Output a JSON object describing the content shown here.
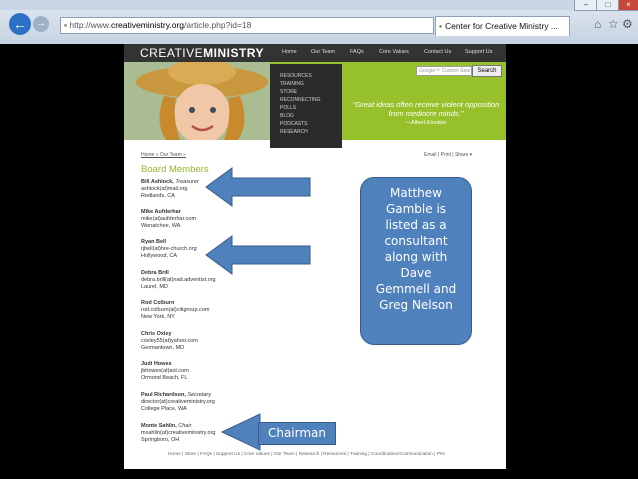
{
  "browser": {
    "url_prefix": "http://www.",
    "url_domain": "creativeministry.org",
    "url_path": "/article.php?id=18",
    "tab_title": "Center for Creative Ministry ...",
    "back_icon": "back-arrow-icon",
    "forward_icon": "forward-arrow-icon"
  },
  "site": {
    "logo_a": "CREATIVE",
    "logo_b": "MINISTRY",
    "nav": [
      "Home",
      "Our Team",
      "FAQs",
      "Core Values",
      "Contact Us",
      "Support Us"
    ],
    "dropdown": [
      "RESOURCES",
      "TRAINING",
      "STORE",
      "RECONNECTING",
      "POLLS",
      "BLOG",
      "PODCASTS",
      "RESEARCH"
    ],
    "search_placeholder": "Google™ Custom Sear",
    "search_button": "Search",
    "quote": "\"Great ideas often receive violent opposition from mediocre minds.\"",
    "quote_author": "—Albert Einstein",
    "breadcrumb": "Home » Our Team »",
    "util_links": "Email | Print | Share ▾",
    "heading": "Board Members",
    "members": [
      {
        "name": "Bill Ashlock,",
        "role": "Treasurer",
        "email": "ashlock(at)mail.org",
        "place": "Redlands, CA"
      },
      {
        "name": "Mike Aufderhar",
        "role": "",
        "email": "mike(at)aufderhar.com",
        "place": "Wenatchee, WA"
      },
      {
        "name": "Ryan Bell",
        "role": "",
        "email": "rjbell(at)hre-church.org",
        "place": "Hollywood, CA"
      },
      {
        "name": "Debra Brill",
        "role": "",
        "email": "debra.brill(at)nad.adventist.org",
        "place": "Laurel, MD"
      },
      {
        "name": "Rod Colburn",
        "role": "",
        "email": "rod.colburn(at)citigroup.com",
        "place": "New York, NY"
      },
      {
        "name": "Chris Oxley",
        "role": "",
        "email": "coxley55(at)yahoo.com",
        "place": "Germantown, MD"
      },
      {
        "name": "Judi Howes",
        "role": "",
        "email": "jbhowes(at)aol.com",
        "place": "Ormond Beach, FL"
      },
      {
        "name": "Paul Richardson,",
        "role": "Secretary",
        "email": "director(at)creativeministry.org",
        "place": "College Place, WA"
      },
      {
        "name": "Monte Sahlin,",
        "role": "Chair",
        "email": "msahlin(at)creativeministry.org",
        "place": "Springboro, OH"
      }
    ],
    "footer": "Home  |  Store  |  FAQs  |  Support Us  |  Core Values  |  Our Team  |  Research  |  Resources  |  Training  |  Coordination/Communication  |  PHI"
  },
  "annotations": {
    "callout": [
      "Matthew",
      "Gamble is",
      "listed as a",
      "consultant",
      "along with",
      "Dave",
      "Gemmell and",
      "Greg Nelson"
    ],
    "chairman_label": "Chairman",
    "arrow_color": "#4f81bd"
  }
}
